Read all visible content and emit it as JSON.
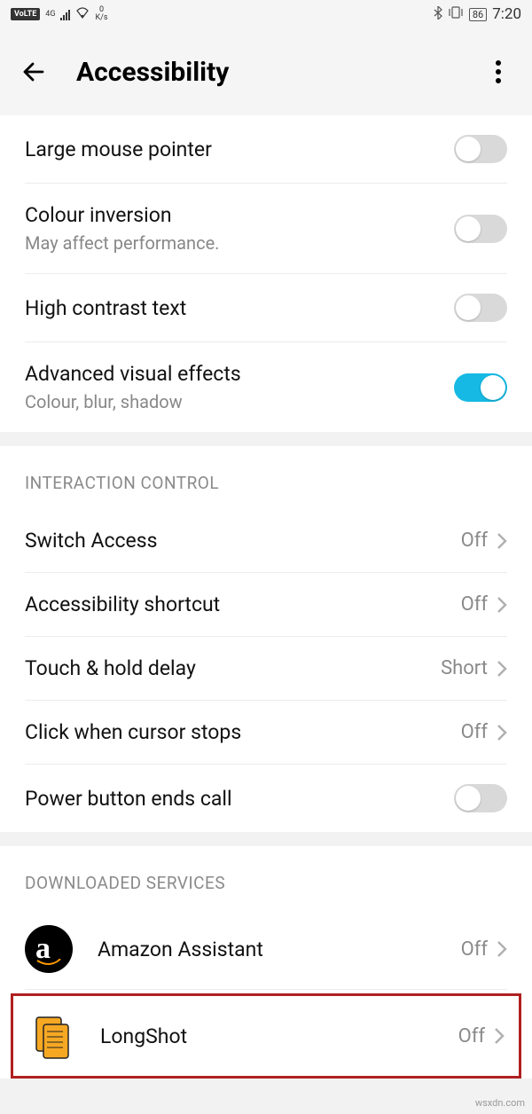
{
  "status": {
    "volte": "VoLTE",
    "network": "4G",
    "speed_value": "0",
    "speed_unit": "K/s",
    "battery": "86",
    "time": "7:20"
  },
  "header": {
    "title": "Accessibility"
  },
  "section_visual": {
    "items": {
      "large_mouse": {
        "label": "Large mouse pointer"
      },
      "colour_inversion": {
        "label": "Colour inversion",
        "desc": "May affect performance."
      },
      "high_contrast": {
        "label": "High contrast text"
      },
      "advanced_visual": {
        "label": "Advanced visual effects",
        "desc": "Colour, blur, shadow"
      }
    }
  },
  "section_interaction": {
    "header": "INTERACTION CONTROL",
    "items": {
      "switch_access": {
        "label": "Switch Access",
        "value": "Off"
      },
      "a11y_shortcut": {
        "label": "Accessibility shortcut",
        "value": "Off"
      },
      "touch_hold": {
        "label": "Touch & hold delay",
        "value": "Short"
      },
      "click_cursor": {
        "label": "Click when cursor stops",
        "value": "Off"
      },
      "power_ends_call": {
        "label": "Power button ends call"
      }
    }
  },
  "section_downloaded": {
    "header": "DOWNLOADED SERVICES",
    "items": {
      "amazon": {
        "label": "Amazon Assistant",
        "value": "Off"
      },
      "longshot": {
        "label": "LongShot",
        "value": "Off"
      }
    }
  },
  "watermark": "wsxdn.com"
}
